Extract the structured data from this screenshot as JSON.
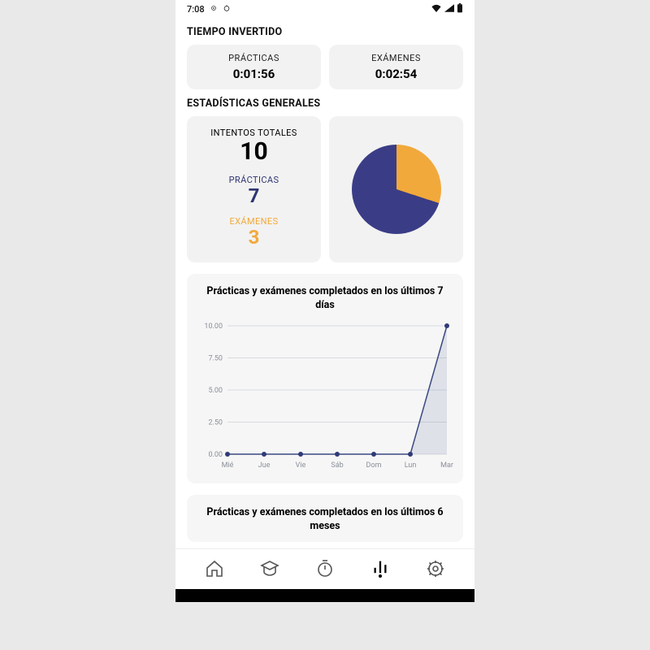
{
  "status": {
    "time": "7:08"
  },
  "sections": {
    "time_invested": {
      "title": "TIEMPO INVERTIDO",
      "practices": {
        "label": "PRÁCTICAS",
        "value": "0:01:56"
      },
      "exams": {
        "label": "EXÁMENES",
        "value": "0:02:54"
      }
    },
    "general_stats": {
      "title": "ESTADÍSTICAS GENERALES",
      "total_label": "INTENTOS TOTALES",
      "total_value": "10",
      "practices_label": "PRÁCTICAS",
      "practices_value": "7",
      "exams_label": "EXÁMENES",
      "exams_value": "3"
    },
    "chart7": {
      "title": "Prácticas y exámenes completados en los últimos 7 días"
    },
    "chart6m": {
      "title": "Prácticas y exámenes completados en los últimos 6 meses"
    }
  },
  "chart_data": [
    {
      "type": "pie",
      "series": [
        {
          "name": "PRÁCTICAS",
          "value": 7,
          "color": "#3a3d86"
        },
        {
          "name": "EXÁMENES",
          "value": 3,
          "color": "#f2a93b"
        }
      ]
    },
    {
      "type": "area",
      "title": "Prácticas y exámenes completados en los últimos 7 días",
      "categories": [
        "Mié",
        "Jue",
        "Vie",
        "Sáb",
        "Dom",
        "Lun",
        "Mar"
      ],
      "values": [
        0,
        0,
        0,
        0,
        0,
        0,
        10
      ],
      "xlabel": "",
      "ylabel": "",
      "ylim": [
        0,
        10
      ],
      "yticks": [
        0.0,
        2.5,
        5.0,
        7.5,
        10.0
      ]
    }
  ],
  "colors": {
    "navy": "#2f3572",
    "orange": "#f2a93b",
    "pie_navy": "#3a3d86"
  }
}
